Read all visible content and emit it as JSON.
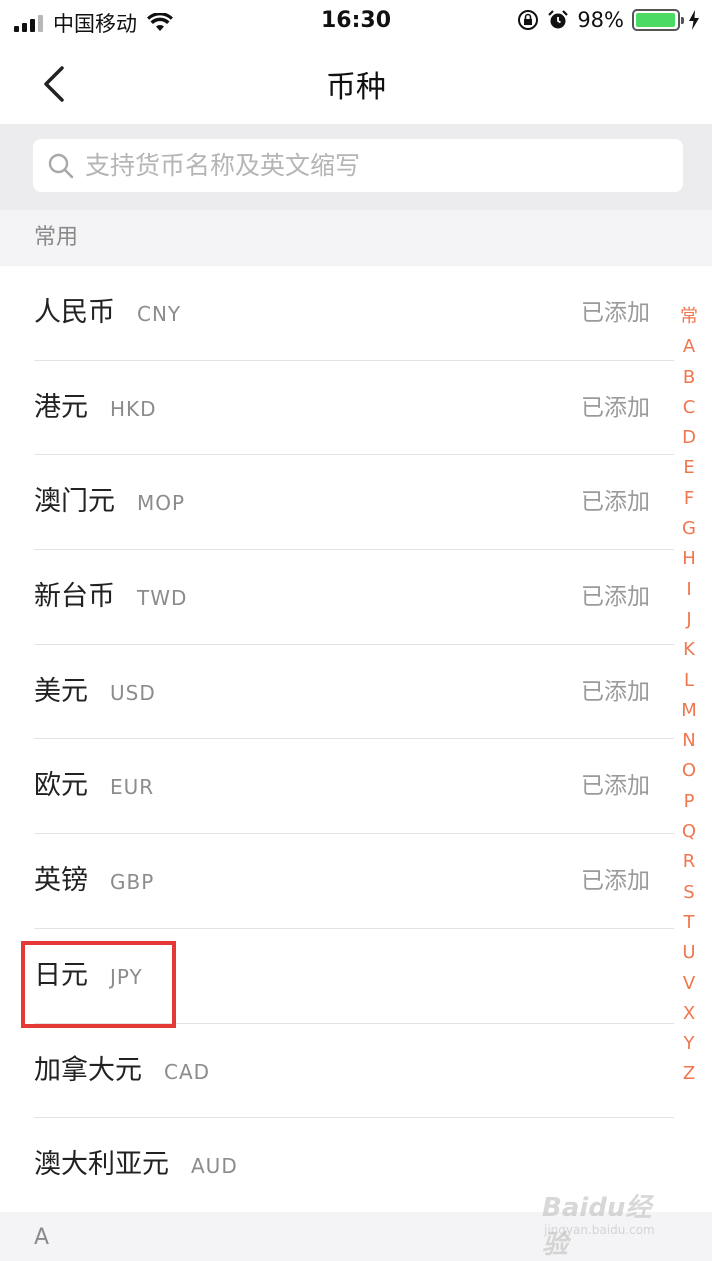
{
  "status_bar": {
    "carrier": "中国移动",
    "time": "16:30",
    "battery_percent": "98%",
    "battery_level": 0.98,
    "icons": [
      "signal-icon",
      "wifi-icon",
      "rotation-lock-icon",
      "alarm-icon",
      "battery-icon",
      "charging-icon"
    ]
  },
  "nav": {
    "title": "币种",
    "back_icon": "chevron-left-icon"
  },
  "search": {
    "placeholder": "支持货币名称及英文缩写",
    "value": ""
  },
  "sections": {
    "common_label": "常用",
    "a_label": "A"
  },
  "currencies": [
    {
      "name": "人民币",
      "code": "CNY",
      "status": "已添加"
    },
    {
      "name": "港元",
      "code": "HKD",
      "status": "已添加"
    },
    {
      "name": "澳门元",
      "code": "MOP",
      "status": "已添加"
    },
    {
      "name": "新台币",
      "code": "TWD",
      "status": "已添加"
    },
    {
      "name": "美元",
      "code": "USD",
      "status": "已添加"
    },
    {
      "name": "欧元",
      "code": "EUR",
      "status": "已添加"
    },
    {
      "name": "英镑",
      "code": "GBP",
      "status": "已添加"
    },
    {
      "name": "日元",
      "code": "JPY",
      "status": ""
    },
    {
      "name": "加拿大元",
      "code": "CAD",
      "status": ""
    },
    {
      "name": "澳大利亚元",
      "code": "AUD",
      "status": ""
    }
  ],
  "index_letters": [
    "常",
    "A",
    "B",
    "C",
    "D",
    "E",
    "F",
    "G",
    "H",
    "I",
    "J",
    "K",
    "L",
    "M",
    "N",
    "O",
    "P",
    "Q",
    "R",
    "S",
    "T",
    "U",
    "V",
    "X",
    "Y",
    "Z"
  ],
  "colors": {
    "accent": "#f0764f",
    "highlight": "#e53935",
    "battery": "#4cd964"
  },
  "watermark": {
    "text": "Baidu经验",
    "sub": "jingyan.baidu.com"
  }
}
